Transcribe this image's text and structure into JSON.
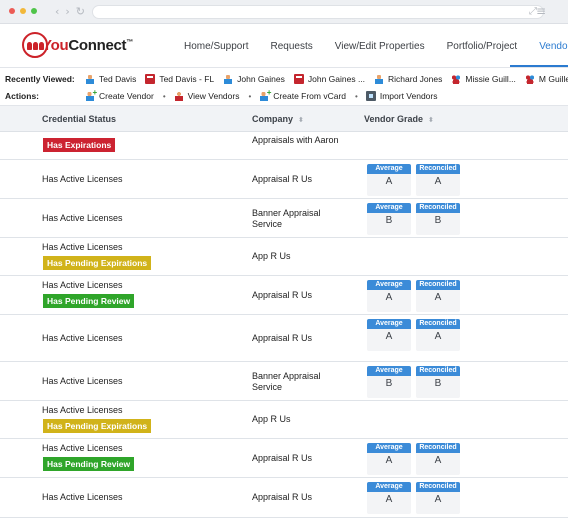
{
  "nav": {
    "items": [
      {
        "label": "Home/Support",
        "active": false
      },
      {
        "label": "Requests",
        "active": false
      },
      {
        "label": "View/Edit Properties",
        "active": false
      },
      {
        "label": "Portfolio/Project",
        "active": false
      },
      {
        "label": "Vendors",
        "active": true
      }
    ]
  },
  "logo": {
    "you": "You",
    "connect": "Connect",
    "tm": "™"
  },
  "recent": {
    "label": "Recently Viewed:",
    "items": [
      {
        "label": "Ted Davis",
        "icon": "person-icon"
      },
      {
        "label": "Ted Davis - FL",
        "icon": "book-icon"
      },
      {
        "label": "John Gaines",
        "icon": "person-icon"
      },
      {
        "label": "John Gaines ...",
        "icon": "book-icon"
      },
      {
        "label": "Richard Jones",
        "icon": "person-icon"
      },
      {
        "label": "Missie Guill...",
        "icon": "group-icon"
      },
      {
        "label": "M Guillette",
        "icon": "group-icon"
      }
    ]
  },
  "actions": {
    "label": "Actions:",
    "items": [
      {
        "label": "Create Vendor"
      },
      {
        "label": "View Vendors"
      },
      {
        "label": "Create From vCard"
      },
      {
        "label": "Import Vendors"
      }
    ]
  },
  "table": {
    "headers": {
      "status": "Credential Status",
      "company": "Company",
      "grade": "Vendor Grade"
    },
    "grade_labels": {
      "average": "Average",
      "reconciled": "Reconciled"
    },
    "rows": [
      {
        "status": "",
        "badge": "Has Expirations",
        "company": "Appraisals with Aaron",
        "average": "",
        "reconciled": ""
      },
      {
        "status": "Has Active Licenses",
        "badge": "",
        "company": "Appraisal R Us",
        "average": "A",
        "reconciled": "A"
      },
      {
        "status": "Has Active Licenses",
        "badge": "",
        "company": "Banner Appraisal Service",
        "average": "B",
        "reconciled": "B"
      },
      {
        "status": "Has Active Licenses",
        "badge": "Has Pending Expirations",
        "company": "App R Us",
        "average": "",
        "reconciled": ""
      },
      {
        "status": "Has Active Licenses",
        "badge": "Has Pending Review",
        "company": "Appraisal R Us",
        "average": "A",
        "reconciled": "A"
      },
      {
        "status": "Has Active Licenses",
        "badge": "",
        "company": "Appraisal R Us",
        "average": "A",
        "reconciled": "A"
      },
      {
        "status": "Has Active Licenses",
        "badge": "",
        "company": "Banner Appraisal Service",
        "average": "B",
        "reconciled": "B"
      },
      {
        "status": "Has Active Licenses",
        "badge": "Has Pending Expirations",
        "company": "App R Us",
        "average": "",
        "reconciled": ""
      },
      {
        "status": "Has Active Licenses",
        "badge": "Has Pending Review",
        "company": "Appraisal R Us",
        "average": "A",
        "reconciled": "A"
      },
      {
        "status": "Has Active Licenses",
        "badge": "",
        "company": "Appraisal R Us",
        "average": "A",
        "reconciled": "A"
      }
    ]
  },
  "colors": {
    "accent": "#2b7bd0",
    "brand": "#cc2229",
    "expired": "#cc2331",
    "pending": "#d1b31a",
    "review": "#2fa52a"
  }
}
